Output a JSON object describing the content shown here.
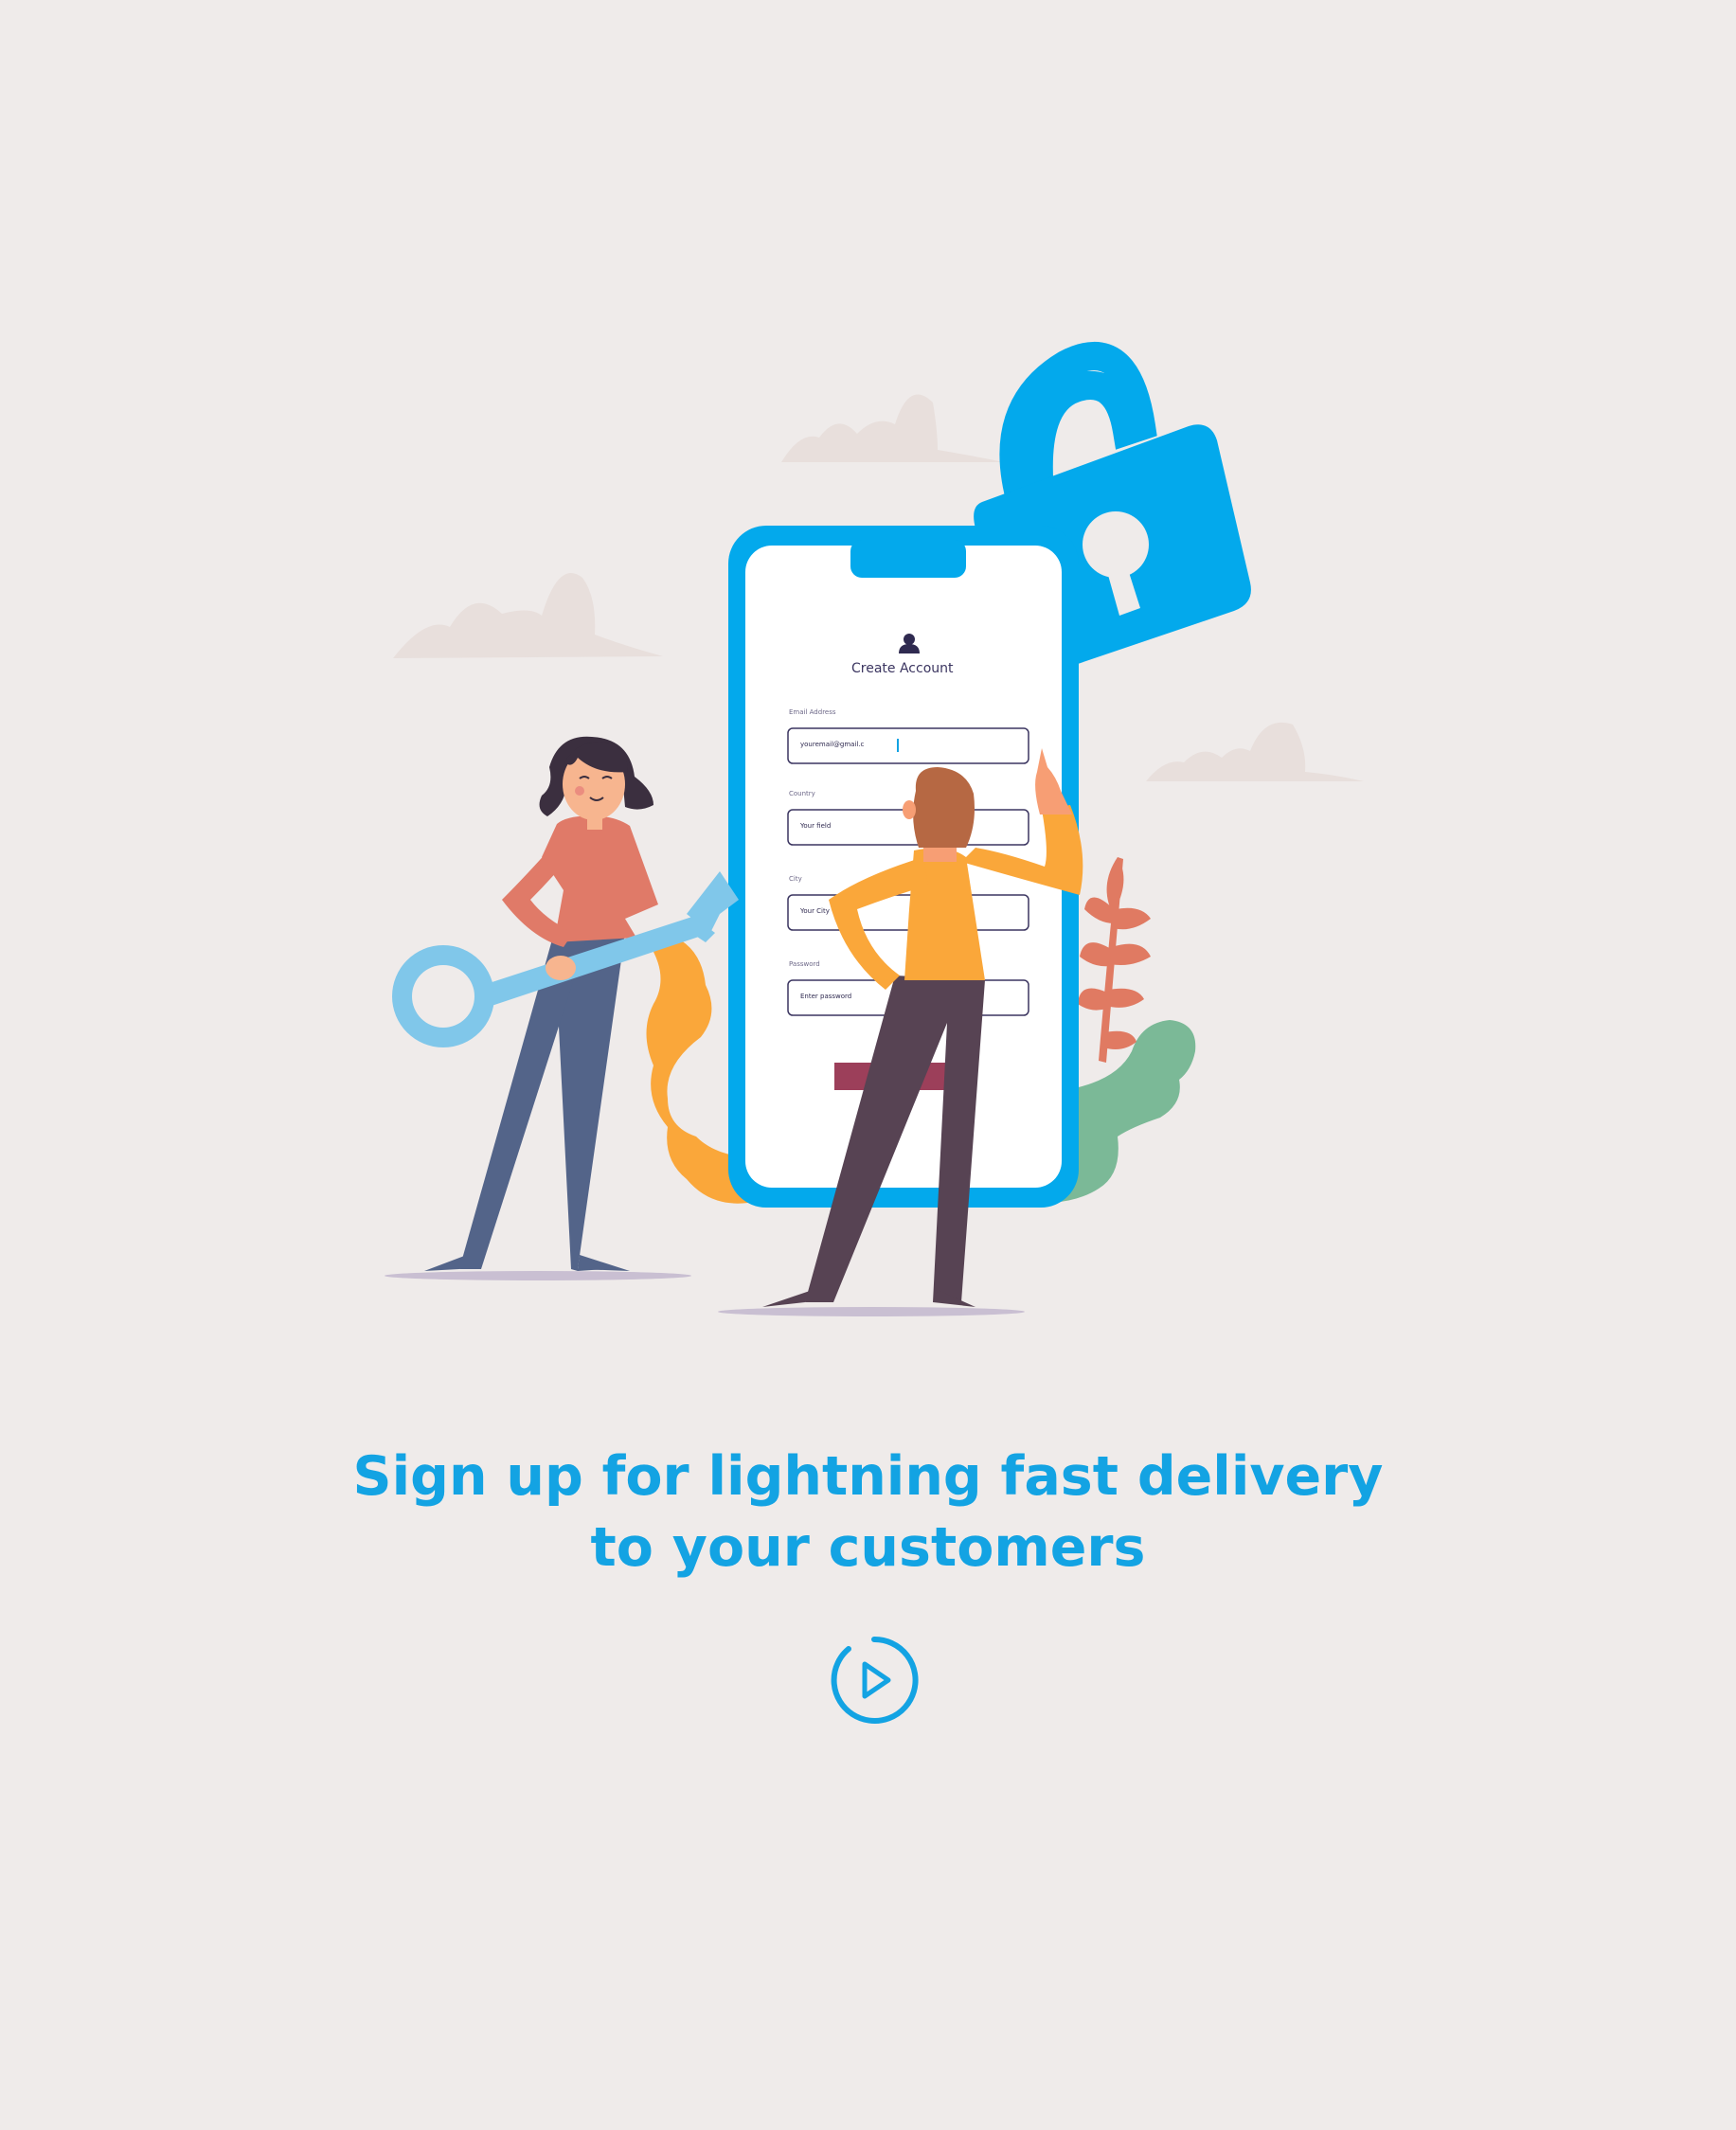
{
  "illustration": {
    "phone": {
      "title": "Create Account",
      "fields": [
        {
          "label": "Email Address",
          "value": "youremail@gmail.c"
        },
        {
          "label": "Country",
          "value": "Your field"
        },
        {
          "label": "City",
          "value": "Your City"
        },
        {
          "label": "Password",
          "value": "Enter password"
        }
      ]
    }
  },
  "headline": {
    "line1": "Sign up for lightning fast delivery",
    "line2": "to your customers"
  },
  "icons": {
    "next": "play-circle-icon",
    "lock": "padlock-icon",
    "key": "key-icon",
    "user": "user-icon"
  },
  "colors": {
    "background": "#efebea",
    "accent": "#13a3e3",
    "phone_frame": "#03a9ec",
    "submit_button": "#9c3f5a",
    "plant_orange": "#faa73a",
    "plant_green": "#7bb997",
    "leaves": "#e07a62"
  }
}
